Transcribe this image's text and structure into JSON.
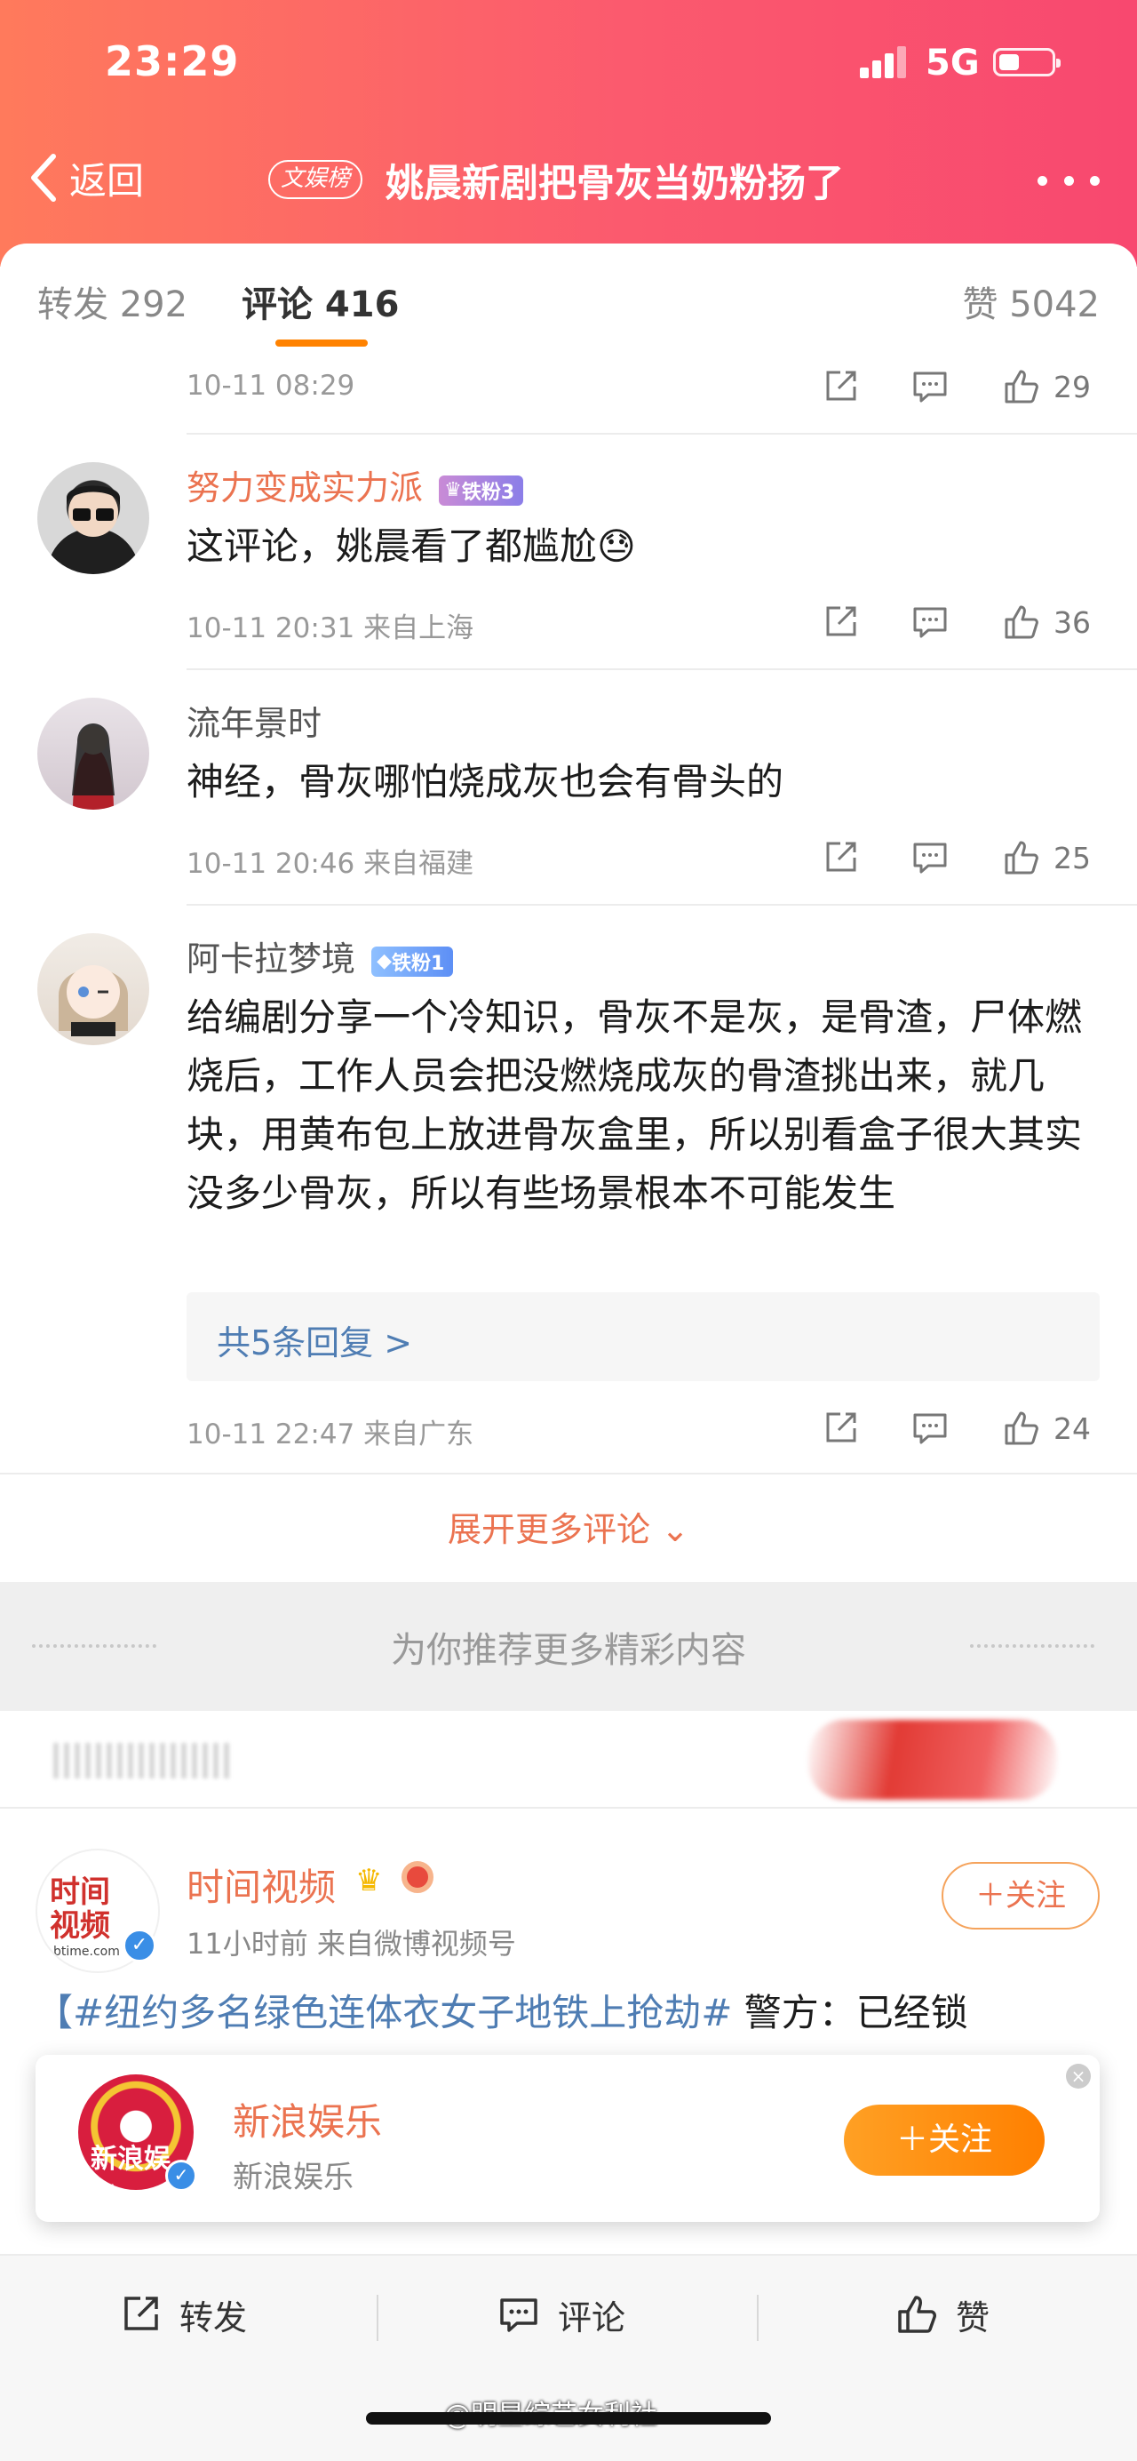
{
  "status_bar": {
    "time": "23:29",
    "network": "5G"
  },
  "nav": {
    "back_label": "返回",
    "topic_badge": "文娱榜",
    "title": "姚晨新剧把骨灰当奶粉扬了"
  },
  "tabs": {
    "repost": "转发 292",
    "comment": "评论 416",
    "like": "赞 5042"
  },
  "comments": [
    {
      "time": "10-11 08:29",
      "likes": "29"
    },
    {
      "username": "努力变成实力派",
      "badge": "铁粉3",
      "text": "这评论，姚晨看了都尴尬😓",
      "time": "10-11 20:31  来自上海",
      "likes": "36"
    },
    {
      "username": "流年景时",
      "text": "神经，骨灰哪怕烧成灰也会有骨头的",
      "time": "10-11 20:46  来自福建",
      "likes": "25"
    },
    {
      "username": "阿卡拉梦境",
      "badge": "铁粉1",
      "text": "给编剧分享一个冷知识，骨灰不是灰，是骨渣，尸体燃烧后，工作人员会把没燃烧成灰的骨渣挑出来，就几块，用黄布包上放进骨灰盒里，所以别看盒子很大其实没多少骨灰，所以有些场景根本不可能发生",
      "replies_link": "共5条回复 >",
      "time": "10-11 22:47  来自广东",
      "likes": "24"
    }
  ],
  "expand_more": "展开更多评论 ⌄",
  "recommend": {
    "banner": "为你推荐更多精彩内容"
  },
  "post": {
    "avatar_text_1": "时间",
    "avatar_text_2": "视频",
    "avatar_sub": "btime.com",
    "author": "时间视频",
    "meta": "11小时前  来自微博视频号",
    "follow": "＋关注",
    "hashtag": "【#纽约多名绿色连体衣女子地铁上抢劫#",
    "body_rest": " 警方：已经锁"
  },
  "float_card": {
    "name": "新浪娱乐",
    "subtitle": "新浪娱乐",
    "avatar_text": "新浪娱乐",
    "follow": "＋关注",
    "close": "×"
  },
  "bottom_bar": {
    "repost": "转发",
    "comment": "评论",
    "like": "赞"
  },
  "watermark": "@明星综艺女利社",
  "icons": {
    "back": "chevron-left-icon",
    "more": "more-dots-icon",
    "share": "share-icon",
    "comment": "comment-icon",
    "like": "thumbs-up-icon"
  },
  "colors": {
    "accent": "#ff8200",
    "username": "#eb7350",
    "link": "#4f7db3",
    "header_start": "#ff7a5c",
    "header_end": "#f8486f"
  }
}
